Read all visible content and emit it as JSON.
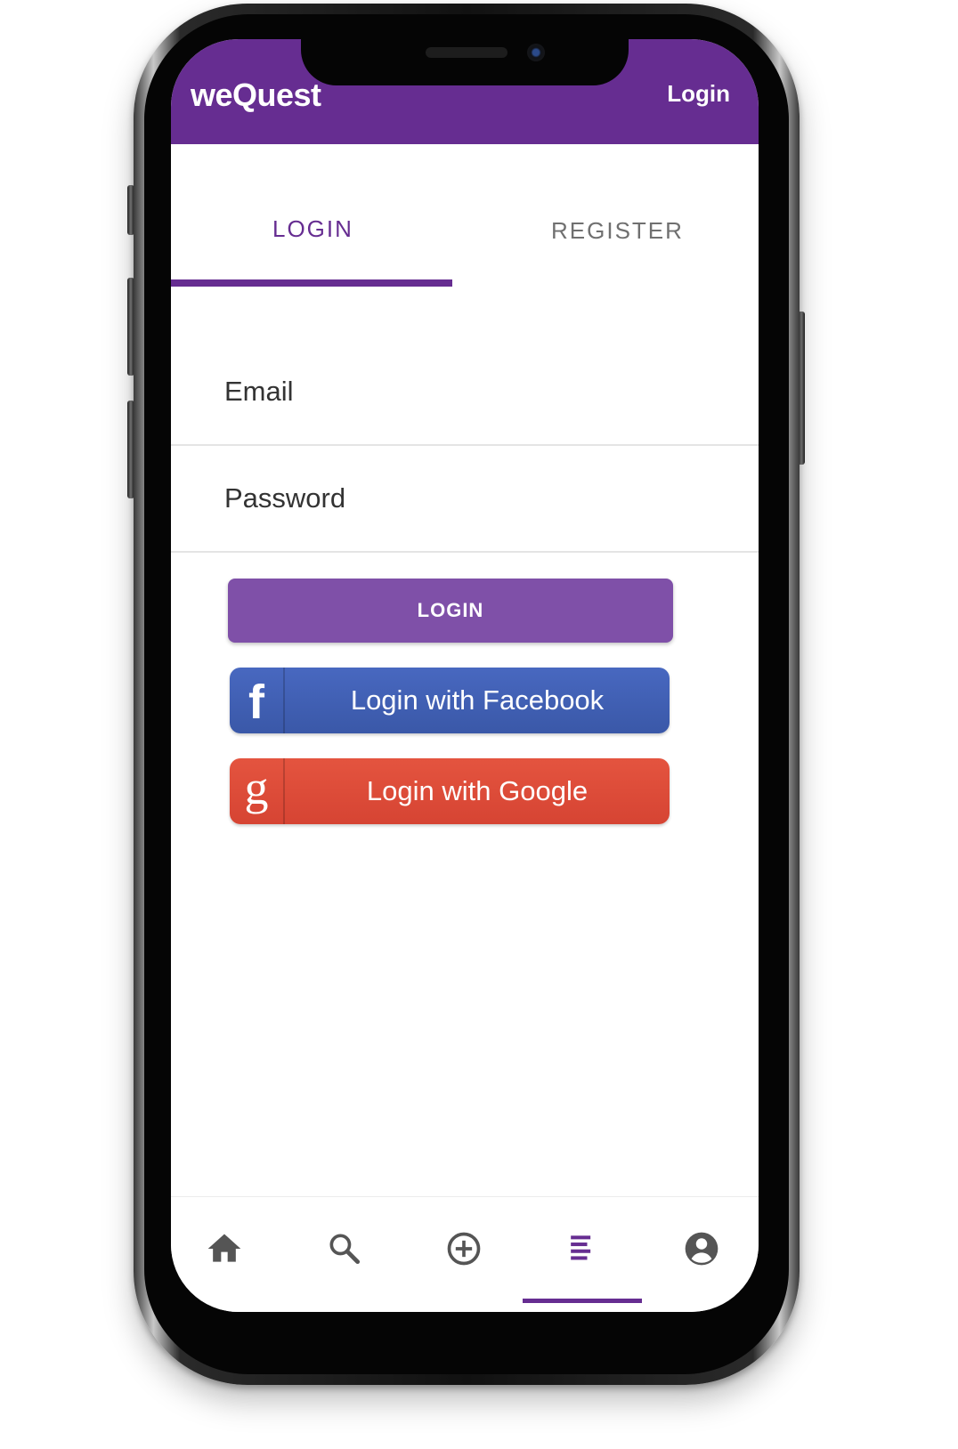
{
  "app": {
    "title": "weQuest",
    "header_login": "Login"
  },
  "tabs": [
    {
      "label": "LOGIN",
      "active": true
    },
    {
      "label": "REGISTER",
      "active": false
    }
  ],
  "form": {
    "email_placeholder": "Email",
    "password_placeholder": "Password",
    "login_button": "LOGIN",
    "facebook_button": "Login with Facebook",
    "google_button": "Login with Google"
  },
  "bottom_nav": {
    "items": [
      {
        "icon": "home-icon",
        "active": false
      },
      {
        "icon": "search-icon",
        "active": false
      },
      {
        "icon": "add-circle-icon",
        "active": false
      },
      {
        "icon": "list-icon",
        "active": true
      },
      {
        "icon": "account-circle-icon",
        "active": false
      }
    ]
  },
  "colors": {
    "primary": "#662d91",
    "login_button": "#7f50a8",
    "facebook": "#3b5998",
    "google": "#dd4b39",
    "inactive_icon": "#555555"
  },
  "icons": {
    "facebook": "facebook-f-icon",
    "google": "google-g-icon"
  }
}
